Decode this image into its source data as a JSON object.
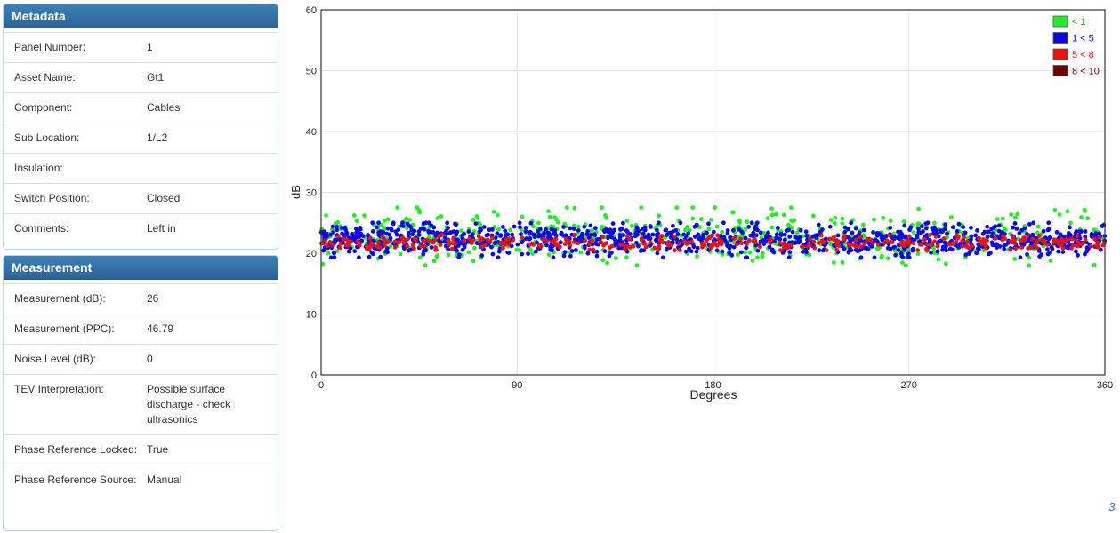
{
  "metadata": {
    "title": "Metadata",
    "rows": [
      {
        "label": "Panel Number:",
        "value": "1"
      },
      {
        "label": "Asset Name:",
        "value": "Gt1"
      },
      {
        "label": "Component:",
        "value": "Cables"
      },
      {
        "label": "Sub Location:",
        "value": "1/L2"
      },
      {
        "label": "Insulation:",
        "value": ""
      },
      {
        "label": "Switch Position:",
        "value": "Closed"
      },
      {
        "label": "Comments:",
        "value": "Left in"
      }
    ]
  },
  "measurement": {
    "title": "Measurement",
    "rows": [
      {
        "label": "Measurement (dB):",
        "value": "26"
      },
      {
        "label": "Measurement (PPC):",
        "value": "46.79"
      },
      {
        "label": "Noise Level (dB):",
        "value": "0"
      },
      {
        "label": "TEV Interpretation:",
        "value": "Possible surface discharge - check ultrasonics"
      },
      {
        "label": "Phase Reference Locked:",
        "value": "True"
      },
      {
        "label": "Phase Reference Source:",
        "value": "Manual"
      }
    ]
  },
  "footer": {
    "text": "3."
  },
  "chart_data": {
    "type": "scatter",
    "xlabel": "Degrees",
    "ylabel": "dB",
    "xlim": [
      0,
      360
    ],
    "ylim": [
      0,
      60
    ],
    "xticks": [
      0,
      90,
      180,
      270,
      360
    ],
    "yticks": [
      0,
      10,
      20,
      30,
      40,
      50,
      60
    ],
    "grid": true,
    "legend_position": "top-right",
    "series": [
      {
        "name": "< 1",
        "color": "#22ee22",
        "text_color": "#11bb11",
        "band": [
          18,
          27.5
        ],
        "count": 520
      },
      {
        "name": "1 < 5",
        "color": "#0a0ae6",
        "text_color": "#0a0ae6",
        "band": [
          19.3,
          25
        ],
        "count": 1150
      },
      {
        "name": "5 < 8",
        "color": "#ee1111",
        "text_color": "#dd1111",
        "band": [
          20.5,
          23
        ],
        "count": 360
      },
      {
        "name": "8 < 10",
        "color": "#6b0505",
        "text_color": "#6b0505",
        "band": [],
        "count": 0
      }
    ]
  }
}
